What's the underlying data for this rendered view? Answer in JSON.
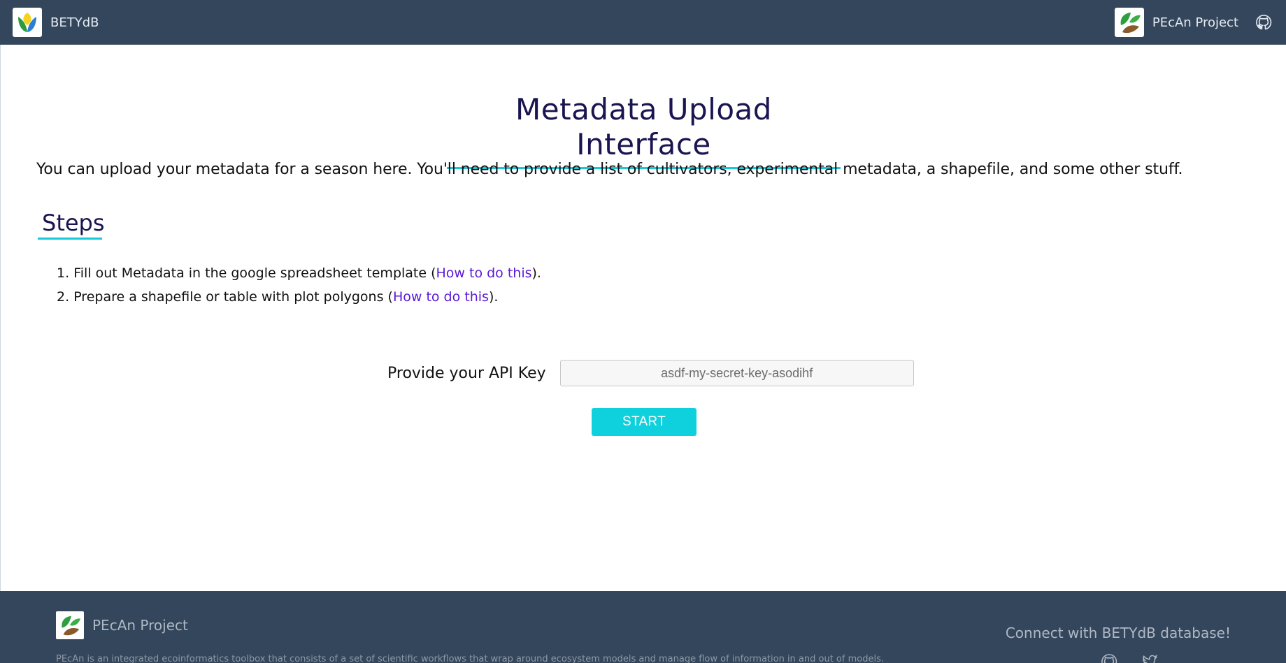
{
  "header": {
    "brand": "BETYdB",
    "project_link": "PEcAn Project",
    "github_icon": "github-icon"
  },
  "main": {
    "title": "Metadata Upload Interface",
    "intro": "You can upload your metadata for a season here. You'll need to provide a list of cultivators, experimental metadata, a shapefile, and some other stuff.",
    "steps_title": "Steps",
    "steps": [
      {
        "num": "1.",
        "before": "Fill out Metadata in the google spreadsheet template (",
        "link": "How to do this",
        "after": ")."
      },
      {
        "num": "2.",
        "before": "Prepare a shapefile or table with plot polygons (",
        "link": "How to do this",
        "after": ")."
      }
    ],
    "api_label": "Provide your API Key",
    "api_placeholder": "asdf-my-secret-key-asodihf",
    "api_value": "",
    "start_button": "START"
  },
  "footer": {
    "brand": "PEcAn Project",
    "description": "PEcAn is an integrated ecoinformatics toolbox that consists of a set of scientific workflows that wrap around ecosystem models and manage flow of information in and out of models.",
    "connect": "Connect with BETYdB database!",
    "icons": [
      "github-icon",
      "twitter-icon"
    ]
  },
  "colors": {
    "navbar_bg": "#34465c",
    "accent_cyan": "#0fd1dd",
    "title_color": "#1a1450",
    "link_color": "#5a19d6"
  }
}
